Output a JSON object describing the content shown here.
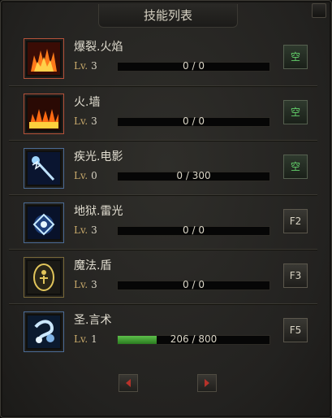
{
  "window": {
    "title": "技能列表"
  },
  "lv_label": "Lv.",
  "skills": [
    {
      "name": "爆裂.火焰",
      "level": "3",
      "progress_text": "0 / 0",
      "progress": 0,
      "key": "空",
      "key_empty": true,
      "icon": "firestorm-icon"
    },
    {
      "name": "火.墙",
      "level": "3",
      "progress_text": "0 / 0",
      "progress": 0,
      "key": "空",
      "key_empty": true,
      "icon": "firewall-icon"
    },
    {
      "name": "疾光.电影",
      "level": "0",
      "progress_text": "0 / 300",
      "progress": 0,
      "key": "空",
      "key_empty": true,
      "icon": "lightning-bolt-icon"
    },
    {
      "name": "地狱.雷光",
      "level": "3",
      "progress_text": "0 / 0",
      "progress": 0,
      "key": "F2",
      "key_empty": false,
      "icon": "hell-lightning-icon"
    },
    {
      "name": "魔法.盾",
      "level": "3",
      "progress_text": "0 / 0",
      "progress": 0,
      "key": "F3",
      "key_empty": false,
      "icon": "magic-shield-icon"
    },
    {
      "name": "圣.言术",
      "level": "1",
      "progress_text": "206 / 800",
      "progress": 0.2575,
      "key": "F5",
      "key_empty": false,
      "icon": "holy-word-icon"
    }
  ],
  "colors": {
    "accent_green": "#63d06a",
    "level_gold": "#c8a96b",
    "progress_green": "#4fae3f",
    "pager_arrow": "#b7322a"
  }
}
